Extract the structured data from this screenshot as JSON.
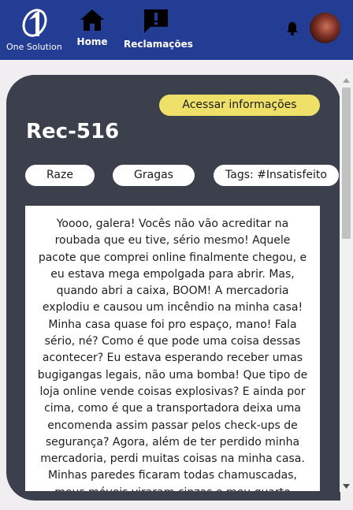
{
  "nav": {
    "logo_text": "One Solution",
    "items": [
      {
        "label": "Home",
        "icon": "home-icon"
      },
      {
        "label": "Reclamações",
        "icon": "report-icon"
      }
    ],
    "bell_icon": "bell-icon",
    "colors": {
      "background": "#243d94",
      "text": "#ffffff"
    }
  },
  "complaint": {
    "access_label": "Acessar informações",
    "title": "Rec-516",
    "tags": [
      "Raze",
      "Gragas",
      "Tags: #Insatisfeito"
    ],
    "body": "Yoooo, galera! Vocês não vão acreditar na roubada que eu tive, sério mesmo! Aquele pacote que comprei online finalmente chegou, e eu estava mega empolgada para abrir. Mas, quando abri a caixa, BOOM! A mercadoria explodiu e causou um incêndio na minha casa! Minha casa quase foi pro espaço, mano! Fala sério, né? Como é que pode uma coisa dessas acontecer? Eu estava esperando receber umas bugigangas legais, não uma bomba! Que tipo de loja online vende coisas explosivas? E ainda por cima, como é que a transportadora deixa uma encomenda assim passar pelos check-ups de segurança? Agora, além de ter perdido minha mercadoria, perdi muitas coisas na minha casa. Minhas paredes ficaram todas chamuscadas, meus móveis viraram cinzas e meu quarto parece",
    "colors": {
      "card": "#3b404c",
      "accent": "#efe06a"
    }
  }
}
